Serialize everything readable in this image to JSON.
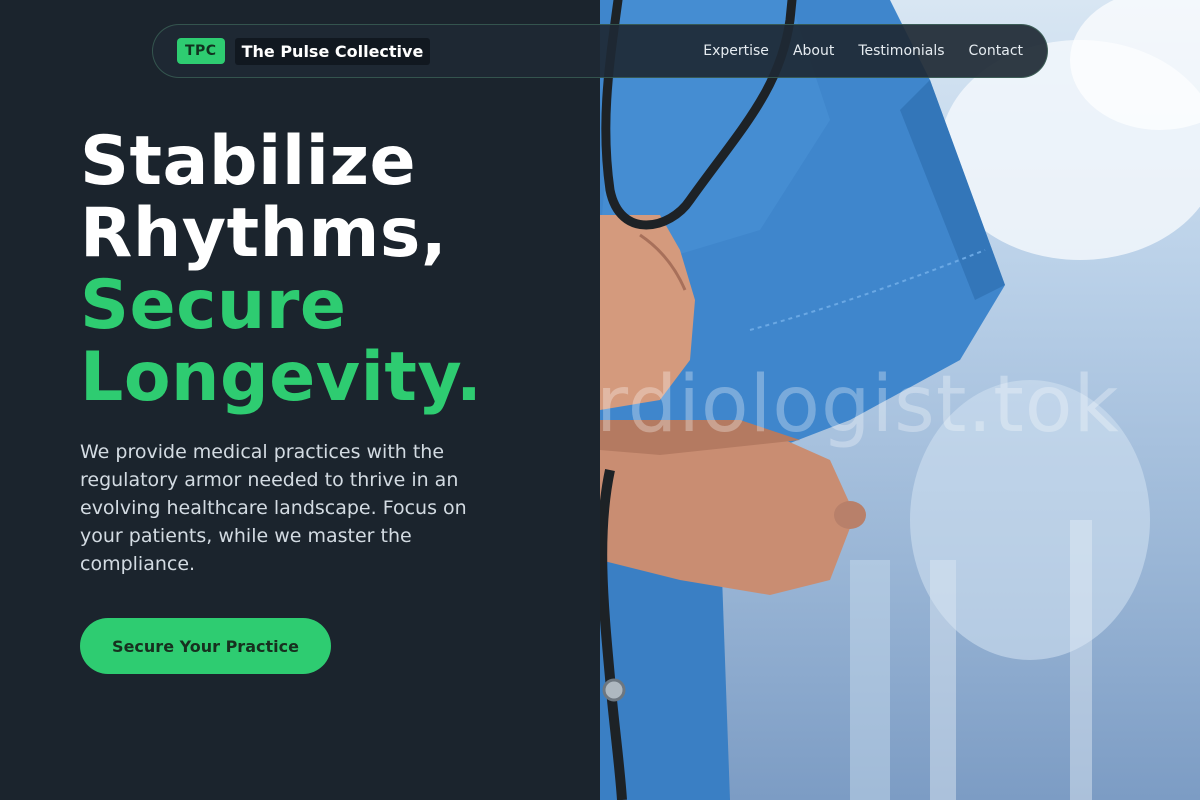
{
  "nav": {
    "badge": "TPC",
    "brand": "The Pulse Collective",
    "links": [
      "Expertise",
      "About",
      "Testimonials",
      "Contact"
    ]
  },
  "hero": {
    "headline_line1": "Stabilize",
    "headline_line2": "Rhythms,",
    "headline_line3": "Secure",
    "headline_line4": "Longevity.",
    "lede": "We provide medical practices with the regulatory armor needed to thrive in an evolving healthcare landscape. Focus on your patients, while we master the compliance.",
    "cta_label": "Secure Your Practice"
  },
  "image": {
    "watermark": "rdiologist.tok",
    "subject": "doctor-in-blue-scrubs-with-stethoscope"
  },
  "colors": {
    "background": "#1b242d",
    "accent": "#2ecc71",
    "scrubs": "#3f86cc"
  }
}
